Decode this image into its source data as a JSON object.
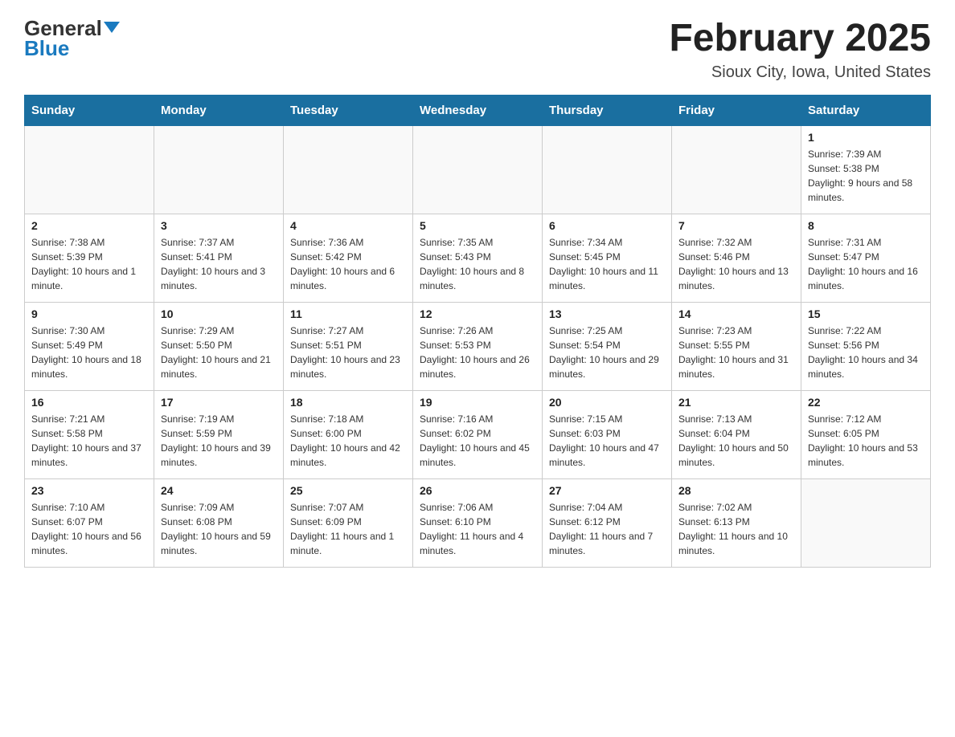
{
  "logo": {
    "general": "General",
    "blue": "Blue"
  },
  "header": {
    "month": "February 2025",
    "location": "Sioux City, Iowa, United States"
  },
  "days_of_week": [
    "Sunday",
    "Monday",
    "Tuesday",
    "Wednesday",
    "Thursday",
    "Friday",
    "Saturday"
  ],
  "weeks": [
    [
      {
        "day": "",
        "info": ""
      },
      {
        "day": "",
        "info": ""
      },
      {
        "day": "",
        "info": ""
      },
      {
        "day": "",
        "info": ""
      },
      {
        "day": "",
        "info": ""
      },
      {
        "day": "",
        "info": ""
      },
      {
        "day": "1",
        "info": "Sunrise: 7:39 AM\nSunset: 5:38 PM\nDaylight: 9 hours and 58 minutes."
      }
    ],
    [
      {
        "day": "2",
        "info": "Sunrise: 7:38 AM\nSunset: 5:39 PM\nDaylight: 10 hours and 1 minute."
      },
      {
        "day": "3",
        "info": "Sunrise: 7:37 AM\nSunset: 5:41 PM\nDaylight: 10 hours and 3 minutes."
      },
      {
        "day": "4",
        "info": "Sunrise: 7:36 AM\nSunset: 5:42 PM\nDaylight: 10 hours and 6 minutes."
      },
      {
        "day": "5",
        "info": "Sunrise: 7:35 AM\nSunset: 5:43 PM\nDaylight: 10 hours and 8 minutes."
      },
      {
        "day": "6",
        "info": "Sunrise: 7:34 AM\nSunset: 5:45 PM\nDaylight: 10 hours and 11 minutes."
      },
      {
        "day": "7",
        "info": "Sunrise: 7:32 AM\nSunset: 5:46 PM\nDaylight: 10 hours and 13 minutes."
      },
      {
        "day": "8",
        "info": "Sunrise: 7:31 AM\nSunset: 5:47 PM\nDaylight: 10 hours and 16 minutes."
      }
    ],
    [
      {
        "day": "9",
        "info": "Sunrise: 7:30 AM\nSunset: 5:49 PM\nDaylight: 10 hours and 18 minutes."
      },
      {
        "day": "10",
        "info": "Sunrise: 7:29 AM\nSunset: 5:50 PM\nDaylight: 10 hours and 21 minutes."
      },
      {
        "day": "11",
        "info": "Sunrise: 7:27 AM\nSunset: 5:51 PM\nDaylight: 10 hours and 23 minutes."
      },
      {
        "day": "12",
        "info": "Sunrise: 7:26 AM\nSunset: 5:53 PM\nDaylight: 10 hours and 26 minutes."
      },
      {
        "day": "13",
        "info": "Sunrise: 7:25 AM\nSunset: 5:54 PM\nDaylight: 10 hours and 29 minutes."
      },
      {
        "day": "14",
        "info": "Sunrise: 7:23 AM\nSunset: 5:55 PM\nDaylight: 10 hours and 31 minutes."
      },
      {
        "day": "15",
        "info": "Sunrise: 7:22 AM\nSunset: 5:56 PM\nDaylight: 10 hours and 34 minutes."
      }
    ],
    [
      {
        "day": "16",
        "info": "Sunrise: 7:21 AM\nSunset: 5:58 PM\nDaylight: 10 hours and 37 minutes."
      },
      {
        "day": "17",
        "info": "Sunrise: 7:19 AM\nSunset: 5:59 PM\nDaylight: 10 hours and 39 minutes."
      },
      {
        "day": "18",
        "info": "Sunrise: 7:18 AM\nSunset: 6:00 PM\nDaylight: 10 hours and 42 minutes."
      },
      {
        "day": "19",
        "info": "Sunrise: 7:16 AM\nSunset: 6:02 PM\nDaylight: 10 hours and 45 minutes."
      },
      {
        "day": "20",
        "info": "Sunrise: 7:15 AM\nSunset: 6:03 PM\nDaylight: 10 hours and 47 minutes."
      },
      {
        "day": "21",
        "info": "Sunrise: 7:13 AM\nSunset: 6:04 PM\nDaylight: 10 hours and 50 minutes."
      },
      {
        "day": "22",
        "info": "Sunrise: 7:12 AM\nSunset: 6:05 PM\nDaylight: 10 hours and 53 minutes."
      }
    ],
    [
      {
        "day": "23",
        "info": "Sunrise: 7:10 AM\nSunset: 6:07 PM\nDaylight: 10 hours and 56 minutes."
      },
      {
        "day": "24",
        "info": "Sunrise: 7:09 AM\nSunset: 6:08 PM\nDaylight: 10 hours and 59 minutes."
      },
      {
        "day": "25",
        "info": "Sunrise: 7:07 AM\nSunset: 6:09 PM\nDaylight: 11 hours and 1 minute."
      },
      {
        "day": "26",
        "info": "Sunrise: 7:06 AM\nSunset: 6:10 PM\nDaylight: 11 hours and 4 minutes."
      },
      {
        "day": "27",
        "info": "Sunrise: 7:04 AM\nSunset: 6:12 PM\nDaylight: 11 hours and 7 minutes."
      },
      {
        "day": "28",
        "info": "Sunrise: 7:02 AM\nSunset: 6:13 PM\nDaylight: 11 hours and 10 minutes."
      },
      {
        "day": "",
        "info": ""
      }
    ]
  ]
}
